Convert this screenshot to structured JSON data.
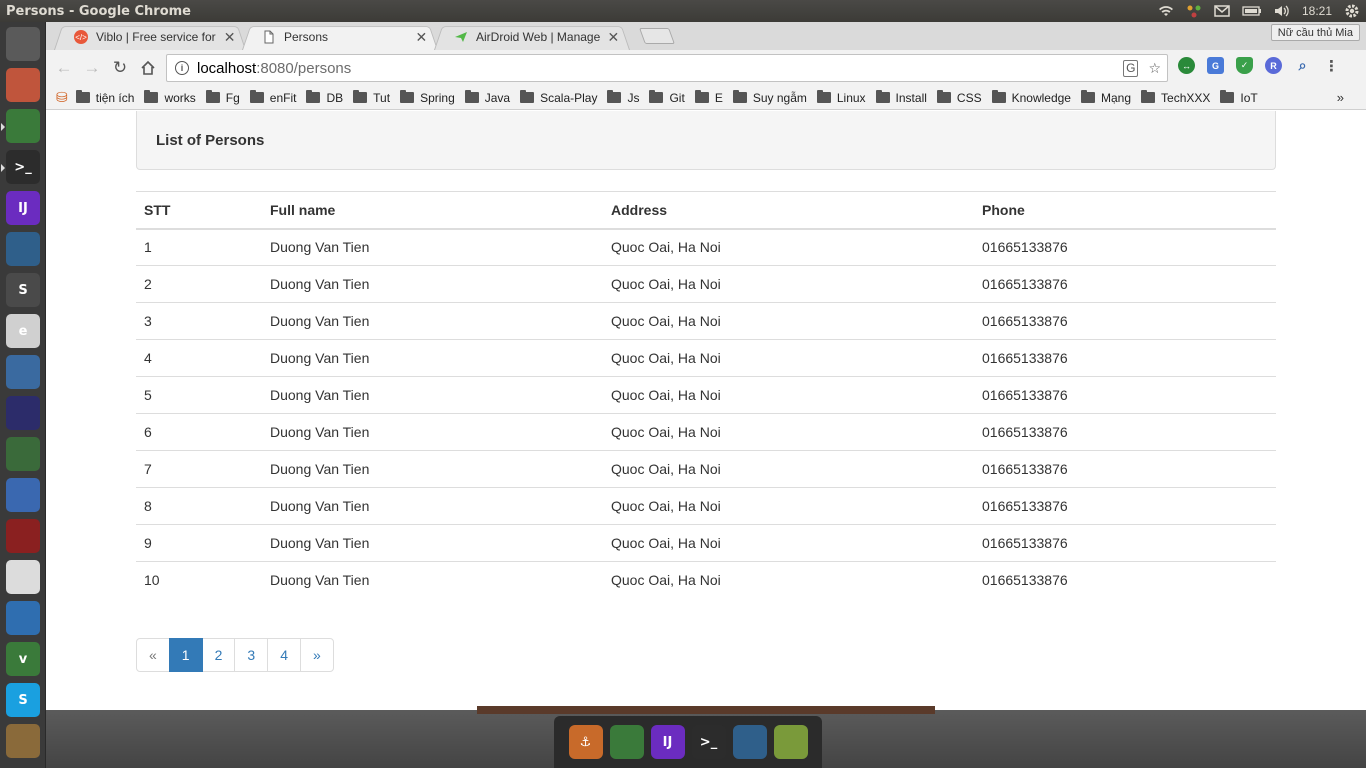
{
  "os": {
    "window_title": "Persons - Google Chrome",
    "clock": "18:21",
    "launcher_items": [
      {
        "name": "ubuntu-dash-icon",
        "label": "",
        "color": "#5a5a5a"
      },
      {
        "name": "file-manager-icon",
        "label": "",
        "color": "#c0553c"
      },
      {
        "name": "chrome-icon",
        "label": "",
        "color": "#3a7a3a"
      },
      {
        "name": "terminal-icon",
        "label": ">_",
        "color": "#2c2c2c"
      },
      {
        "name": "intellij-icon",
        "label": "IJ",
        "color": "#6b2cc0"
      },
      {
        "name": "mysql-workbench-icon",
        "label": "",
        "color": "#2f5f8a"
      },
      {
        "name": "sublime-text-icon",
        "label": "S",
        "color": "#4a4a4a"
      },
      {
        "name": "text-editor-icon",
        "label": "e",
        "color": "#d0d0d0"
      },
      {
        "name": "virtualbox-icon",
        "label": "",
        "color": "#3a6aa0"
      },
      {
        "name": "eclipse-icon",
        "label": "",
        "color": "#2c2c6a"
      },
      {
        "name": "calculator-icon",
        "label": "",
        "color": "#3a6a3a"
      },
      {
        "name": "thunderbird-icon",
        "label": "",
        "color": "#3a68b0"
      },
      {
        "name": "wine-icon",
        "label": "",
        "color": "#8a2020"
      },
      {
        "name": "gedit-icon",
        "label": "",
        "color": "#dcdcdc"
      },
      {
        "name": "document-viewer-icon",
        "label": "",
        "color": "#2f6eb0"
      },
      {
        "name": "vim-icon",
        "label": "v",
        "color": "#3a7a3a"
      },
      {
        "name": "skype-icon",
        "label": "S",
        "color": "#1aa0e0"
      },
      {
        "name": "archive-manager-icon",
        "label": "",
        "color": "#8a6a3a"
      }
    ],
    "dock_items": [
      {
        "name": "anchor-icon",
        "label": "⚓",
        "color": "#c86a2a"
      },
      {
        "name": "chrome-dock-icon",
        "label": "",
        "color": "#3a7a3a"
      },
      {
        "name": "intellij-dock-icon",
        "label": "IJ",
        "color": "#6b2cc0"
      },
      {
        "name": "terminal-dock-icon",
        "label": ">_",
        "color": "#2c2c2c"
      },
      {
        "name": "mysql-dock-icon",
        "label": "",
        "color": "#2f5f8a"
      },
      {
        "name": "shotwell-dock-icon",
        "label": "",
        "color": "#7a9a3a"
      }
    ]
  },
  "browser": {
    "tabs": [
      {
        "title": "Viblo | Free service for technical",
        "favicon_color": "#e8583a"
      },
      {
        "title": "Persons",
        "favicon_color": "#888888"
      },
      {
        "title": "AirDroid Web | Manage your",
        "favicon_color": "#52b847"
      }
    ],
    "profile_name": "Nữ cầu thủ Mia",
    "url_host": "localhost",
    "url_path": ":8080/persons",
    "bookmarks": [
      "tiện ích",
      "works",
      "Fg",
      "enFit",
      "DB",
      "Tut",
      "Spring",
      "Java",
      "Scala-Play",
      "Js",
      "Git",
      "E",
      "Suy ngẫm",
      "Linux",
      "Install",
      "CSS",
      "Knowledge",
      "Mạng",
      "TechXXX",
      "IoT"
    ],
    "bookmarks_more": "»"
  },
  "page": {
    "heading": "List of Persons",
    "columns": [
      "STT",
      "Full name",
      "Address",
      "Phone"
    ],
    "rows": [
      [
        "1",
        "Duong Van Tien",
        "Quoc Oai, Ha Noi",
        "01665133876"
      ],
      [
        "2",
        "Duong Van Tien",
        "Quoc Oai, Ha Noi",
        "01665133876"
      ],
      [
        "3",
        "Duong Van Tien",
        "Quoc Oai, Ha Noi",
        "01665133876"
      ],
      [
        "4",
        "Duong Van Tien",
        "Quoc Oai, Ha Noi",
        "01665133876"
      ],
      [
        "5",
        "Duong Van Tien",
        "Quoc Oai, Ha Noi",
        "01665133876"
      ],
      [
        "6",
        "Duong Van Tien",
        "Quoc Oai, Ha Noi",
        "01665133876"
      ],
      [
        "7",
        "Duong Van Tien",
        "Quoc Oai, Ha Noi",
        "01665133876"
      ],
      [
        "8",
        "Duong Van Tien",
        "Quoc Oai, Ha Noi",
        "01665133876"
      ],
      [
        "9",
        "Duong Van Tien",
        "Quoc Oai, Ha Noi",
        "01665133876"
      ],
      [
        "10",
        "Duong Van Tien",
        "Quoc Oai, Ha Noi",
        "01665133876"
      ]
    ],
    "pagination": {
      "prev": "«",
      "pages": [
        "1",
        "2",
        "3",
        "4"
      ],
      "active": "1",
      "next": "»"
    },
    "colors": {
      "link": "#337ab7",
      "active_page_bg": "#337ab7"
    }
  }
}
